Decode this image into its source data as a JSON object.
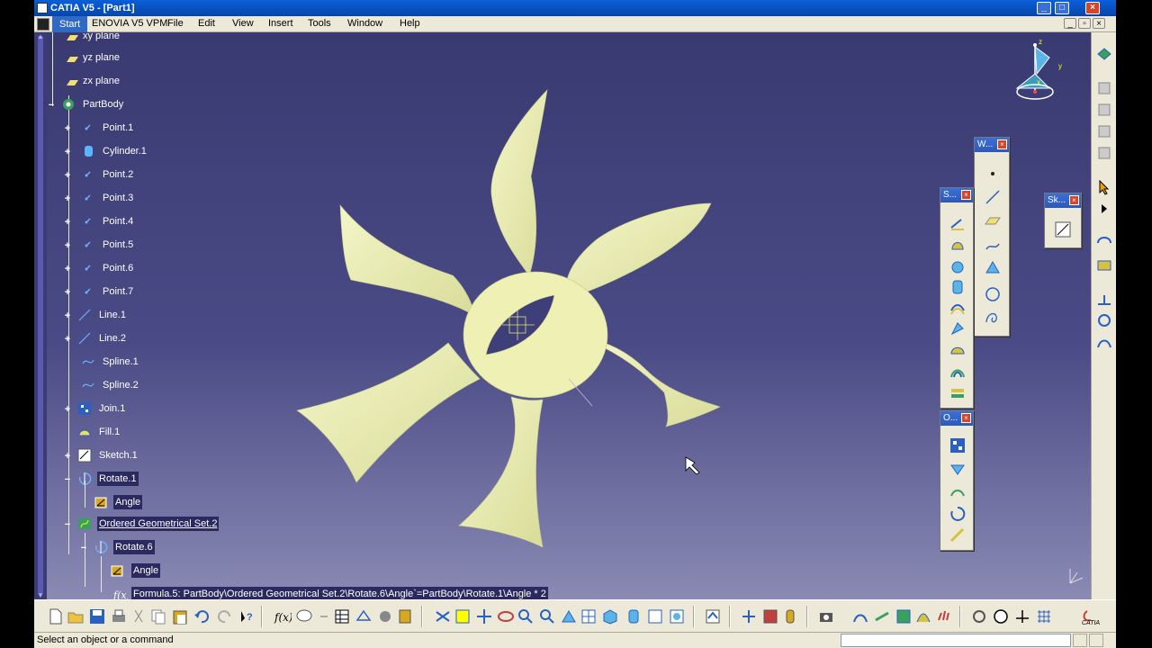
{
  "window": {
    "title": "CATIA V5 - [Part1]"
  },
  "menu": {
    "items": [
      "Start",
      "ENOVIA V5 VPM",
      "File",
      "Edit",
      "View",
      "Insert",
      "Tools",
      "Window",
      "Help"
    ]
  },
  "tree": {
    "nodes": [
      {
        "label": "xy plane"
      },
      {
        "label": "yz plane"
      },
      {
        "label": "zx plane"
      },
      {
        "label": "PartBody"
      },
      {
        "label": "Point.1"
      },
      {
        "label": "Cylinder.1"
      },
      {
        "label": "Point.2"
      },
      {
        "label": "Point.3"
      },
      {
        "label": "Point.4"
      },
      {
        "label": "Point.5"
      },
      {
        "label": "Point.6"
      },
      {
        "label": "Point.7"
      },
      {
        "label": "Line.1"
      },
      {
        "label": "Line.2"
      },
      {
        "label": "Spline.1"
      },
      {
        "label": "Spline.2"
      },
      {
        "label": "Join.1"
      },
      {
        "label": "Fill.1"
      },
      {
        "label": "Sketch.1"
      },
      {
        "label": "Rotate.1"
      },
      {
        "label": "Angle"
      },
      {
        "label": "Ordered Geometrical Set.2"
      },
      {
        "label": "Rotate.6"
      },
      {
        "label": "Angle"
      },
      {
        "label": "Formula.5:  PartBody\\Ordered Geometrical Set.2\\Rotate.6\\Angle`=PartBody\\Rotate.1\\Angle * 2"
      }
    ]
  },
  "compass": {
    "x": "x",
    "y": "y",
    "z": "z"
  },
  "palettes": {
    "wireframe": {
      "title": "W..."
    },
    "surfaces": {
      "title": "S..."
    },
    "sketcher": {
      "title": "Sk..."
    },
    "operations": {
      "title": "O..."
    }
  },
  "status": {
    "message": "Select an object or a command"
  },
  "colors": {
    "part": "#eef0b4",
    "viewport_top": "#3a3a72",
    "viewport_bottom": "#8a8ab4",
    "selection": "#2a2a60"
  }
}
